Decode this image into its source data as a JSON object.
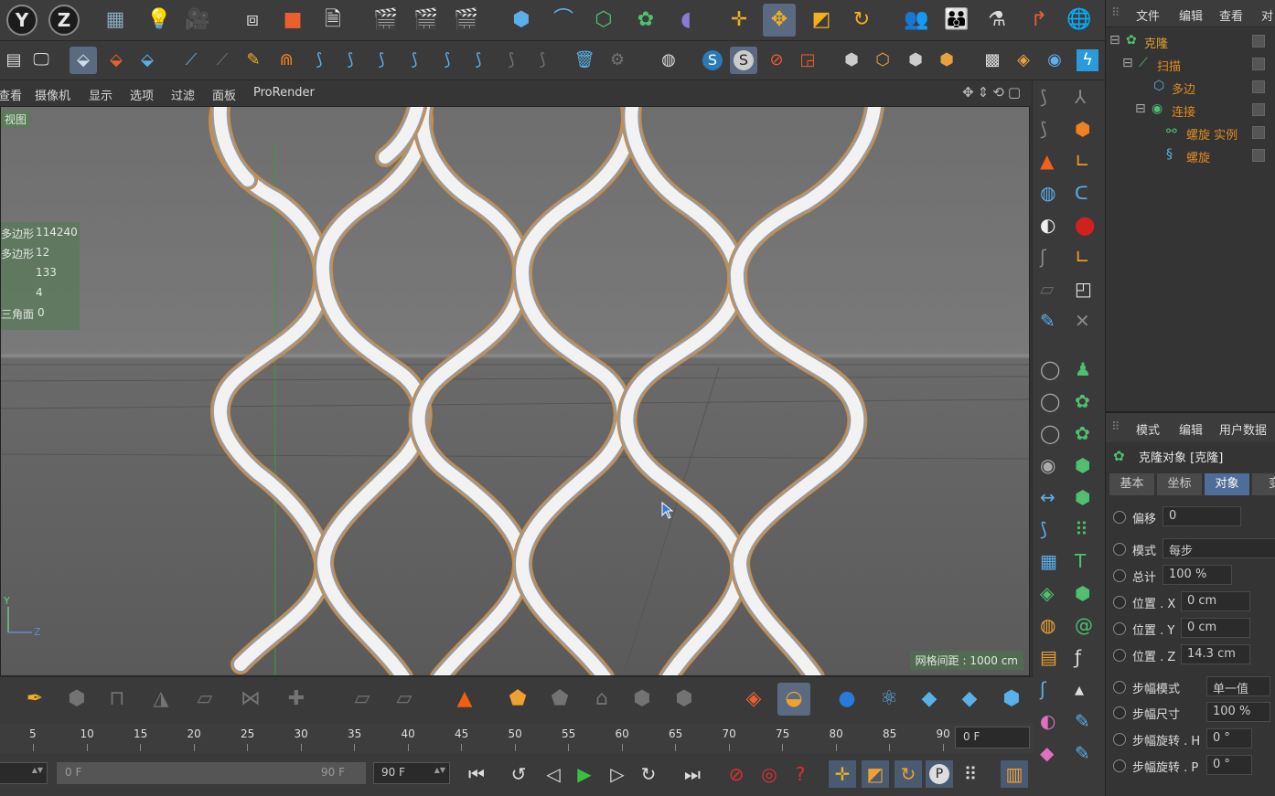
{
  "toolbar1": {
    "axis_y": "Y",
    "axis_z": "Z"
  },
  "viewport_menu": {
    "items": [
      "查看",
      "摄像机",
      "显示",
      "选项",
      "过滤",
      "面板",
      "ProRender"
    ]
  },
  "viewport": {
    "view_label": "视图",
    "stats": [
      {
        "key": "多边形",
        "value": "114240"
      },
      {
        "key": "多边形",
        "value": "12"
      },
      {
        "key": "",
        "value": "133"
      },
      {
        "key": "",
        "value": "4"
      },
      {
        "key": "三角面",
        "value": "0"
      }
    ],
    "grid_spacing": "网格间距 : 1000 cm",
    "axis_y": "Y",
    "axis_z": "Z"
  },
  "object_manager": {
    "menu": [
      "文件",
      "编辑",
      "查看",
      "对"
    ],
    "objects": [
      {
        "name": "克隆",
        "color": "#e0a030"
      },
      {
        "name": "扫描",
        "color": "#e08a20"
      },
      {
        "name": "多边",
        "color": "#e08a20"
      },
      {
        "name": "连接",
        "color": "#e08a20"
      },
      {
        "name": "螺旋 实例",
        "color": "#e08a20"
      },
      {
        "name": "螺旋",
        "color": "#e08a20"
      }
    ]
  },
  "attribute_manager": {
    "menu": [
      "模式",
      "编辑",
      "用户数据"
    ],
    "title": "克隆对象 [克隆]",
    "tabs": [
      "基本",
      "坐标",
      "对象",
      "变"
    ],
    "active_tab": "对象",
    "fields": [
      {
        "name": "偏移",
        "value": "0"
      },
      {
        "name": "模式",
        "value": "每步"
      },
      {
        "name": "总计",
        "value": "100 %"
      },
      {
        "name": "位置 . X",
        "value": "0 cm"
      },
      {
        "name": "位置 . Y",
        "value": "0 cm"
      },
      {
        "name": "位置 . Z",
        "value": "14.3 cm"
      },
      {
        "name": "步幅模式",
        "value": "单一值"
      },
      {
        "name": "步幅尺寸",
        "value": "100 %"
      },
      {
        "name": "步幅旋转 . H",
        "value": "0 °"
      },
      {
        "name": "步幅旋转 . P",
        "value": "0 °"
      }
    ]
  },
  "timeline": {
    "ticks": [
      "5",
      "10",
      "15",
      "20",
      "25",
      "30",
      "35",
      "40",
      "45",
      "50",
      "55",
      "60",
      "65",
      "70",
      "75",
      "80",
      "85",
      "90"
    ],
    "current_frame": "0 F"
  },
  "transport": {
    "range_start": "0 F",
    "range_end": "90 F",
    "end_field": "90 F"
  },
  "colors": {
    "wire": "#f2f2f2",
    "wire_outline": "#d08a3a",
    "active_tab": "#4f6d99"
  }
}
